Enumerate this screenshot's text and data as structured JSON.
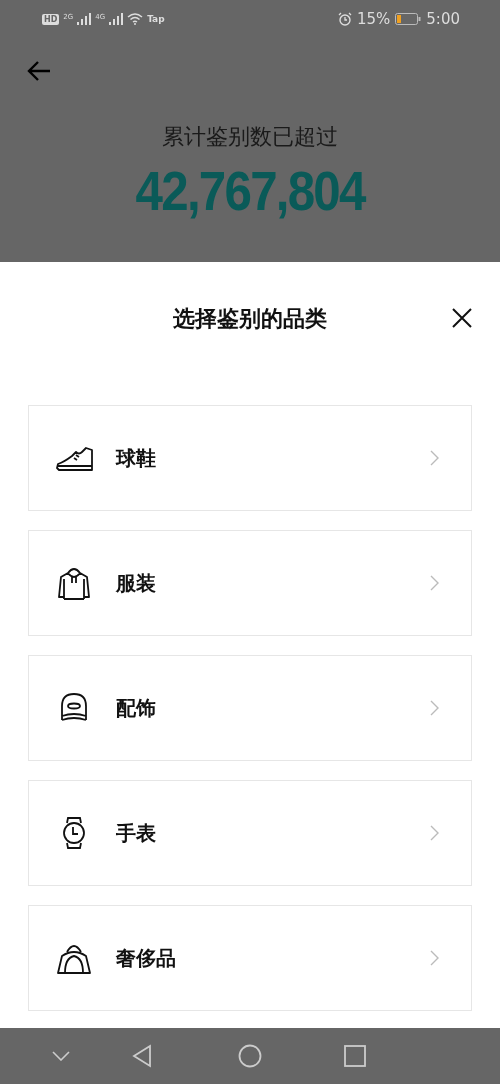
{
  "status_bar": {
    "hd": "HD",
    "sim1": "2G",
    "sim2": "4G",
    "hotspot": "Tap",
    "battery": "15%",
    "time": "5:00"
  },
  "header": {
    "caption": "累计鉴别数已超过",
    "count": "42,767,804"
  },
  "sheet": {
    "title": "选择鉴别的品类",
    "categories": [
      {
        "kind": "sneaker",
        "label": "球鞋"
      },
      {
        "kind": "hoodie",
        "label": "服装"
      },
      {
        "kind": "cap",
        "label": "配饰"
      },
      {
        "kind": "watch",
        "label": "手表"
      },
      {
        "kind": "bag",
        "label": "奢侈品"
      }
    ]
  }
}
